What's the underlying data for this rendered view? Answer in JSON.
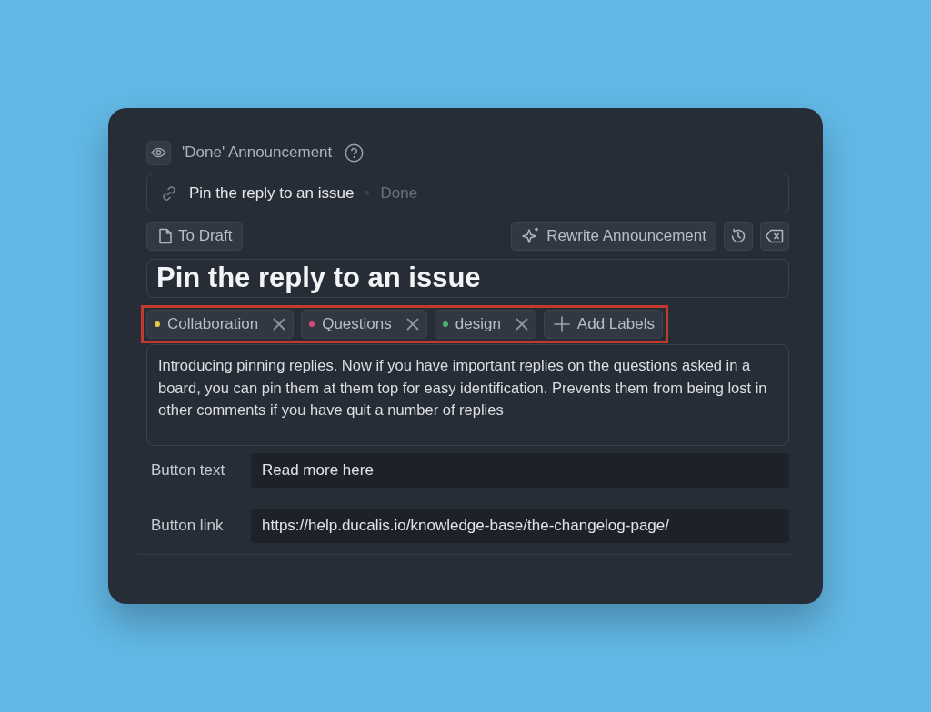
{
  "header": {
    "title": "'Done' Announcement"
  },
  "linked_issue": {
    "title": "Pin the reply to an issue",
    "status": "Done"
  },
  "toolbar": {
    "draft_button": "To Draft",
    "rewrite_button": "Rewrite Announcement"
  },
  "title": "Pin the reply to an issue",
  "labels_highlighted": true,
  "labels": [
    {
      "name": "Collaboration",
      "color": "#e6c84c"
    },
    {
      "name": "Questions",
      "color": "#d9487f"
    },
    {
      "name": "design",
      "color": "#4fae76"
    }
  ],
  "add_labels": "Add Labels",
  "description": "Introducing pinning replies. Now if you have important replies on the questions asked in a board, you can pin them at them top for easy identification. Prevents them from being lost in other comments if you have quit a number of replies",
  "fields": [
    {
      "label": "Button text",
      "value": "Read more here"
    },
    {
      "label": "Button link",
      "value": "https://help.ducalis.io/knowledge-base/the-changelog-page/"
    }
  ]
}
